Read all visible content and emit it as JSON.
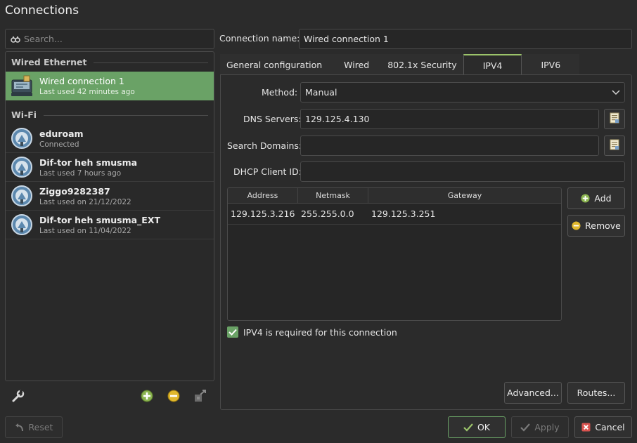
{
  "window": {
    "title": "Connections"
  },
  "search": {
    "placeholder": "Search..."
  },
  "groups": [
    {
      "label": "Wired Ethernet",
      "items": [
        {
          "name": "Wired connection 1",
          "sub": "Last used 42 minutes ago",
          "icon": "wired-network-icon",
          "selected": true
        }
      ]
    },
    {
      "label": "Wi-Fi",
      "items": [
        {
          "name": "eduroam",
          "sub": "Connected",
          "icon": "wifi-network-icon"
        },
        {
          "name": "Dif-tor heh smusma",
          "sub": "Last used 7 hours ago",
          "icon": "wifi-network-icon"
        },
        {
          "name": "Ziggo9282387",
          "sub": "Last used on 21/12/2022",
          "icon": "wifi-network-icon"
        },
        {
          "name": "Dif-tor heh smusma_EXT",
          "sub": "Last used on 11/04/2022",
          "icon": "wifi-network-icon"
        }
      ]
    }
  ],
  "connection_name": {
    "label": "Connection name:",
    "value": "Wired connection 1"
  },
  "tabs": [
    {
      "label": "General configuration"
    },
    {
      "label": "Wired"
    },
    {
      "label": "802.1x Security"
    },
    {
      "label": "IPV4",
      "active": true
    },
    {
      "label": "IPV6"
    }
  ],
  "ipv4": {
    "method_label": "Method:",
    "method_value": "Manual",
    "dns_label": "DNS Servers:",
    "dns_value": "129.125.4.130",
    "search_domains_label": "Search Domains:",
    "search_domains_value": "",
    "dhcp_label": "DHCP Client ID:",
    "dhcp_value": "",
    "table": {
      "headers": [
        "Address",
        "Netmask",
        "Gateway"
      ],
      "rows": [
        [
          "129.125.3.216",
          "255.255.0.0",
          "129.125.3.251"
        ]
      ]
    },
    "add_label": "Add",
    "remove_label": "Remove",
    "required_label": "IPV4 is required for this connection",
    "required_checked": true,
    "advanced_label": "Advanced...",
    "routes_label": "Routes..."
  },
  "footer": {
    "reset_label": "Reset",
    "ok_label": "OK",
    "apply_label": "Apply",
    "cancel_label": "Cancel"
  },
  "colors": {
    "accent_green": "#6aa266",
    "tab_active_border": "#9bc36a",
    "background": "#2b2b2b",
    "cancel_red": "#d9534f"
  }
}
